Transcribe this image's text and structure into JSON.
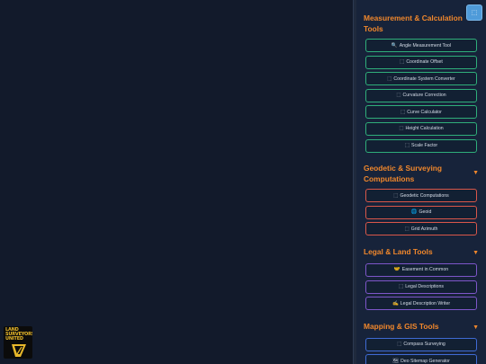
{
  "logo": {
    "text": "LAND SURVEYORS UNITED"
  },
  "float_button": {
    "icon": "expand-icon",
    "glyph": "⬚"
  },
  "sections": [
    {
      "title": "Measurement & Calculation Tools",
      "caret": "▼",
      "color": "#2fae7a",
      "tools": [
        {
          "icon": "🔍",
          "label": "Angle Measurement Tool"
        },
        {
          "icon": "⬚",
          "label": "Coordinate Offset"
        },
        {
          "icon": "⬚",
          "label": "Coordinate System Converter"
        },
        {
          "icon": "⬚",
          "label": "Curvature Correction"
        },
        {
          "icon": "⬚",
          "label": "Curve Calculator"
        },
        {
          "icon": "⬚",
          "label": "Height Calculation"
        },
        {
          "icon": "⬚",
          "label": "Scale Factor"
        }
      ]
    },
    {
      "title": "Geodetic & Surveying Computations",
      "caret": "▼",
      "color": "#d9574a",
      "tools": [
        {
          "icon": "⬚",
          "label": "Geodetic Computations"
        },
        {
          "icon": "🌐",
          "label": "Geoid"
        },
        {
          "icon": "⬚",
          "label": "Grid Azimuth"
        }
      ]
    },
    {
      "title": "Legal & Land Tools",
      "caret": "▼",
      "color": "#7d56c9",
      "tools": [
        {
          "icon": "🤝",
          "label": "Easement in Common"
        },
        {
          "icon": "⬚",
          "label": "Legal Descriptions"
        },
        {
          "icon": "✍",
          "label": "Legal Description Writer"
        }
      ]
    },
    {
      "title": "Mapping & GIS Tools",
      "caret": "▼",
      "color": "#3f6bd4",
      "tools": [
        {
          "icon": "⬚",
          "label": "Compass Surveying"
        },
        {
          "icon": "🗺",
          "label": "Deo Sitemap Generator"
        }
      ]
    }
  ]
}
